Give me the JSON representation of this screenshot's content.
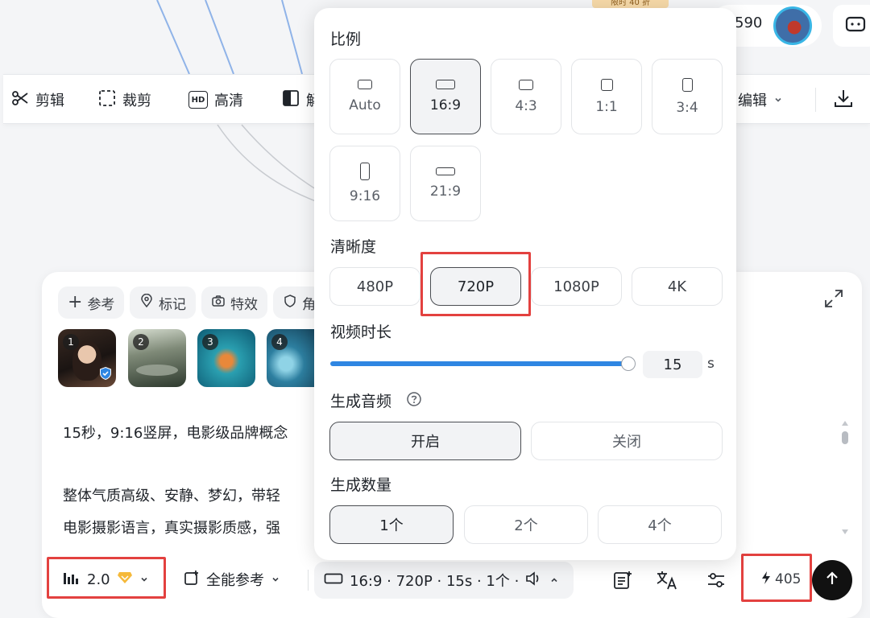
{
  "header": {
    "badge_text": "限时 40 折",
    "credits": "590"
  },
  "toolbar": {
    "cut_label": "剪辑",
    "crop_label": "裁剪",
    "hd_label": "高清",
    "hd_icon_text": "HD",
    "partial_label": "解",
    "edit_label": "编辑"
  },
  "composer": {
    "chips": [
      "参考",
      "标记",
      "特效",
      "角"
    ],
    "thumbnails": [
      "1",
      "2",
      "3",
      "4"
    ],
    "prompt_lines": [
      "15秒，9:16竖屏，电影级品牌概念",
      "整体气质高级、安静、梦幻，带轻",
      "电影摄影语言，真实摄影质感，强"
    ],
    "model_version": "2.0",
    "reference_mode": "全能参考",
    "settings_summary": "16:9 · 720P · 15s · 1个 ·",
    "credits_cost": "405"
  },
  "popover": {
    "ratio_title": "比例",
    "ratios": [
      {
        "label": "Auto",
        "active": false
      },
      {
        "label": "16:9",
        "active": true
      },
      {
        "label": "4:3",
        "active": false
      },
      {
        "label": "1:1",
        "active": false
      },
      {
        "label": "3:4",
        "active": false
      },
      {
        "label": "9:16",
        "active": false
      },
      {
        "label": "21:9",
        "active": false
      }
    ],
    "resolution_title": "清晰度",
    "resolutions": [
      {
        "label": "480P",
        "active": false
      },
      {
        "label": "720P",
        "active": true
      },
      {
        "label": "1080P",
        "active": false
      },
      {
        "label": "4K",
        "active": false
      }
    ],
    "duration_title": "视频时长",
    "duration_value": "15",
    "duration_unit": "s",
    "duration_fraction": 1.0,
    "audio_title": "生成音频",
    "audio_on": "开启",
    "audio_off": "关闭",
    "count_title": "生成数量",
    "counts": [
      {
        "label": "1个",
        "active": true
      },
      {
        "label": "2个",
        "active": false
      },
      {
        "label": "4个",
        "active": false
      }
    ]
  },
  "colors": {
    "accent_blue": "#2f86e2",
    "highlight_red": "#e3413f",
    "gold_badge": "#f5b93a"
  }
}
